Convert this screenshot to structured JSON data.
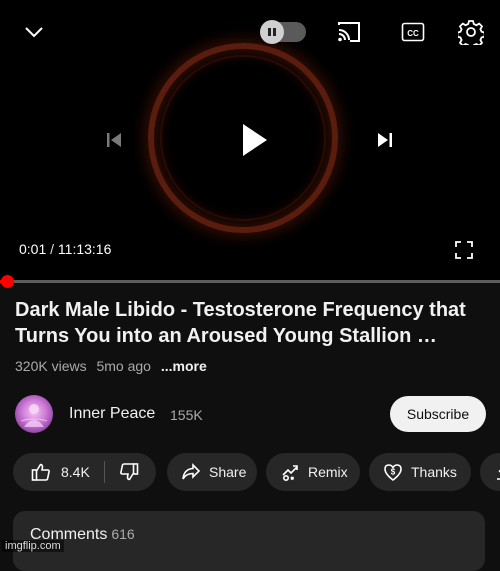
{
  "player": {
    "current_time": "0:01",
    "separator": "/",
    "duration": "11:13:16",
    "progress_fraction": 2e-05,
    "autoplay_on": false,
    "icons": {
      "collapse": "chevron-down-icon",
      "autoplay": "autoplay-toggle",
      "cast": "cast-icon",
      "captions": "captions-icon",
      "settings": "gear-icon",
      "previous": "skip-previous-icon",
      "play": "play-icon",
      "next": "skip-next-icon",
      "fullscreen": "fullscreen-icon"
    }
  },
  "video": {
    "title": "Dark Male Libido - Testosterone Frequency that Turns You into an Aroused Young Stallion …",
    "views": "320K views",
    "age": "5mo ago",
    "more_label": "...more"
  },
  "channel": {
    "name": "Inner Peace",
    "subscribers": "155K",
    "subscribe_label": "Subscribe"
  },
  "actions": {
    "like_count": "8.4K",
    "share_label": "Share",
    "remix_label": "Remix",
    "thanks_label": "Thanks"
  },
  "comments": {
    "label": "Comments",
    "count": "616"
  },
  "watermark": "imgflip.com",
  "colors": {
    "background": "#0f0f0f",
    "accent_red": "#ff0000",
    "pill": "#272727",
    "subscribe_bg": "#f1f1f1"
  }
}
